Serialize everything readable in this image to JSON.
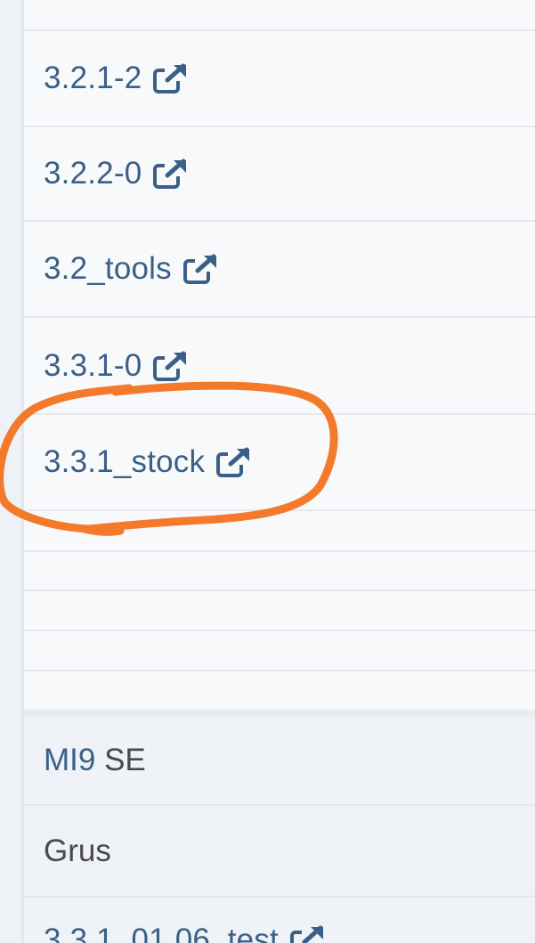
{
  "links": [
    {
      "label": "3.2.1-2"
    },
    {
      "label": "3.2.2-0"
    },
    {
      "label": "3.2_tools"
    },
    {
      "label": "3.3.1-0"
    },
    {
      "label": "3.3.1_stock"
    }
  ],
  "device": {
    "model_link": "MI9",
    "model_suffix": " SE",
    "codename": "Grus"
  },
  "bottom_link": {
    "label": "3.3.1_01.06_test"
  },
  "colors": {
    "link": "#3b6088",
    "annotation": "#f47a2b",
    "background": "#f8f9fb",
    "section_background": "#eff2f6"
  },
  "icons": {
    "external": "external-link-icon"
  }
}
